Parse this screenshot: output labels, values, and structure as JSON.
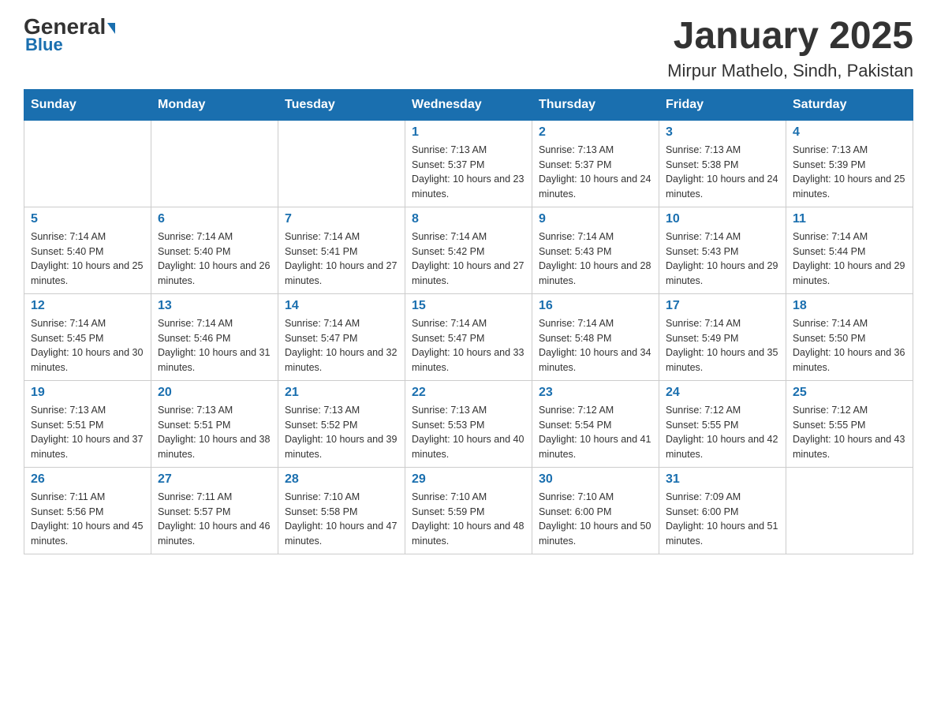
{
  "logo": {
    "text1": "General",
    "text2": "Blue"
  },
  "title": "January 2025",
  "location": "Mirpur Mathelo, Sindh, Pakistan",
  "days_of_week": [
    "Sunday",
    "Monday",
    "Tuesday",
    "Wednesday",
    "Thursday",
    "Friday",
    "Saturday"
  ],
  "weeks": [
    [
      {
        "day": "",
        "info": ""
      },
      {
        "day": "",
        "info": ""
      },
      {
        "day": "",
        "info": ""
      },
      {
        "day": "1",
        "info": "Sunrise: 7:13 AM\nSunset: 5:37 PM\nDaylight: 10 hours and 23 minutes."
      },
      {
        "day": "2",
        "info": "Sunrise: 7:13 AM\nSunset: 5:37 PM\nDaylight: 10 hours and 24 minutes."
      },
      {
        "day": "3",
        "info": "Sunrise: 7:13 AM\nSunset: 5:38 PM\nDaylight: 10 hours and 24 minutes."
      },
      {
        "day": "4",
        "info": "Sunrise: 7:13 AM\nSunset: 5:39 PM\nDaylight: 10 hours and 25 minutes."
      }
    ],
    [
      {
        "day": "5",
        "info": "Sunrise: 7:14 AM\nSunset: 5:40 PM\nDaylight: 10 hours and 25 minutes."
      },
      {
        "day": "6",
        "info": "Sunrise: 7:14 AM\nSunset: 5:40 PM\nDaylight: 10 hours and 26 minutes."
      },
      {
        "day": "7",
        "info": "Sunrise: 7:14 AM\nSunset: 5:41 PM\nDaylight: 10 hours and 27 minutes."
      },
      {
        "day": "8",
        "info": "Sunrise: 7:14 AM\nSunset: 5:42 PM\nDaylight: 10 hours and 27 minutes."
      },
      {
        "day": "9",
        "info": "Sunrise: 7:14 AM\nSunset: 5:43 PM\nDaylight: 10 hours and 28 minutes."
      },
      {
        "day": "10",
        "info": "Sunrise: 7:14 AM\nSunset: 5:43 PM\nDaylight: 10 hours and 29 minutes."
      },
      {
        "day": "11",
        "info": "Sunrise: 7:14 AM\nSunset: 5:44 PM\nDaylight: 10 hours and 29 minutes."
      }
    ],
    [
      {
        "day": "12",
        "info": "Sunrise: 7:14 AM\nSunset: 5:45 PM\nDaylight: 10 hours and 30 minutes."
      },
      {
        "day": "13",
        "info": "Sunrise: 7:14 AM\nSunset: 5:46 PM\nDaylight: 10 hours and 31 minutes."
      },
      {
        "day": "14",
        "info": "Sunrise: 7:14 AM\nSunset: 5:47 PM\nDaylight: 10 hours and 32 minutes."
      },
      {
        "day": "15",
        "info": "Sunrise: 7:14 AM\nSunset: 5:47 PM\nDaylight: 10 hours and 33 minutes."
      },
      {
        "day": "16",
        "info": "Sunrise: 7:14 AM\nSunset: 5:48 PM\nDaylight: 10 hours and 34 minutes."
      },
      {
        "day": "17",
        "info": "Sunrise: 7:14 AM\nSunset: 5:49 PM\nDaylight: 10 hours and 35 minutes."
      },
      {
        "day": "18",
        "info": "Sunrise: 7:14 AM\nSunset: 5:50 PM\nDaylight: 10 hours and 36 minutes."
      }
    ],
    [
      {
        "day": "19",
        "info": "Sunrise: 7:13 AM\nSunset: 5:51 PM\nDaylight: 10 hours and 37 minutes."
      },
      {
        "day": "20",
        "info": "Sunrise: 7:13 AM\nSunset: 5:51 PM\nDaylight: 10 hours and 38 minutes."
      },
      {
        "day": "21",
        "info": "Sunrise: 7:13 AM\nSunset: 5:52 PM\nDaylight: 10 hours and 39 minutes."
      },
      {
        "day": "22",
        "info": "Sunrise: 7:13 AM\nSunset: 5:53 PM\nDaylight: 10 hours and 40 minutes."
      },
      {
        "day": "23",
        "info": "Sunrise: 7:12 AM\nSunset: 5:54 PM\nDaylight: 10 hours and 41 minutes."
      },
      {
        "day": "24",
        "info": "Sunrise: 7:12 AM\nSunset: 5:55 PM\nDaylight: 10 hours and 42 minutes."
      },
      {
        "day": "25",
        "info": "Sunrise: 7:12 AM\nSunset: 5:55 PM\nDaylight: 10 hours and 43 minutes."
      }
    ],
    [
      {
        "day": "26",
        "info": "Sunrise: 7:11 AM\nSunset: 5:56 PM\nDaylight: 10 hours and 45 minutes."
      },
      {
        "day": "27",
        "info": "Sunrise: 7:11 AM\nSunset: 5:57 PM\nDaylight: 10 hours and 46 minutes."
      },
      {
        "day": "28",
        "info": "Sunrise: 7:10 AM\nSunset: 5:58 PM\nDaylight: 10 hours and 47 minutes."
      },
      {
        "day": "29",
        "info": "Sunrise: 7:10 AM\nSunset: 5:59 PM\nDaylight: 10 hours and 48 minutes."
      },
      {
        "day": "30",
        "info": "Sunrise: 7:10 AM\nSunset: 6:00 PM\nDaylight: 10 hours and 50 minutes."
      },
      {
        "day": "31",
        "info": "Sunrise: 7:09 AM\nSunset: 6:00 PM\nDaylight: 10 hours and 51 minutes."
      },
      {
        "day": "",
        "info": ""
      }
    ]
  ]
}
